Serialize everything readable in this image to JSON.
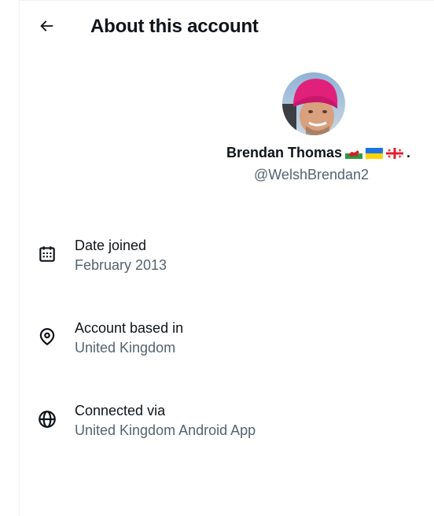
{
  "header": {
    "title": "About this account"
  },
  "profile": {
    "name": "Brendan Thomas",
    "name_suffix": ".",
    "handle": "@WelshBrendan2",
    "flags": [
      "wales-flag",
      "ukraine-flag",
      "georgia-flag"
    ]
  },
  "details": [
    {
      "label": "Date joined",
      "value": "February 2013",
      "icon": "calendar-icon"
    },
    {
      "label": "Account based in",
      "value": "United Kingdom",
      "icon": "location-pin-icon"
    },
    {
      "label": "Connected via",
      "value": "United Kingdom Android App",
      "icon": "globe-icon"
    }
  ],
  "colors": {
    "text_primary": "#0f1419",
    "text_secondary": "#536471",
    "border": "#eff3f4"
  }
}
